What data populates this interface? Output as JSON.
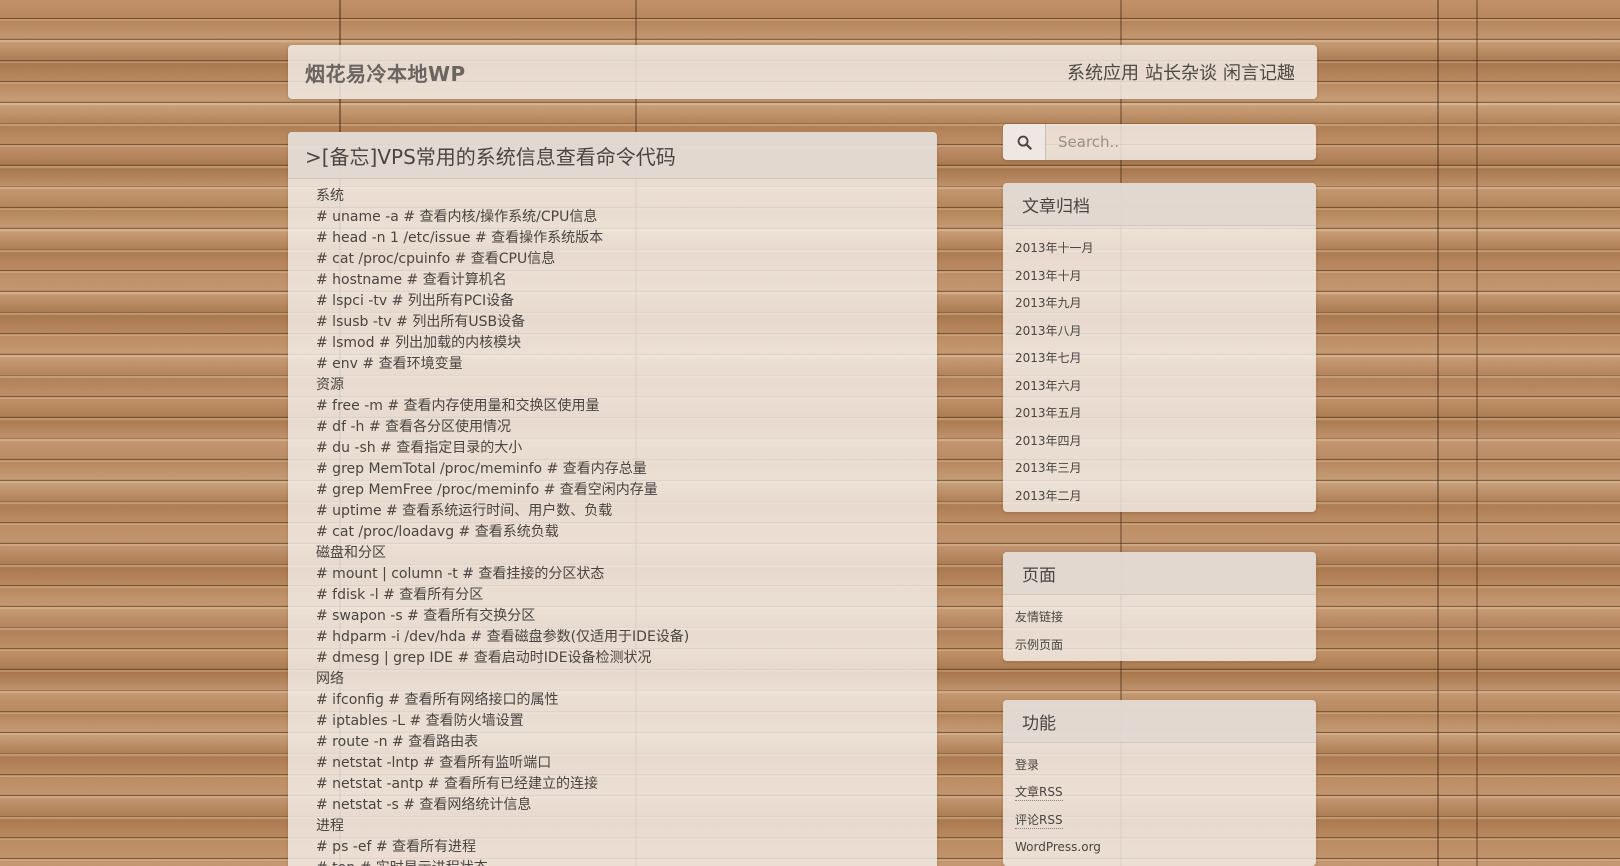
{
  "site": {
    "title": "烟花易冷本地WP",
    "nav": [
      "系统应用",
      "站长杂谈",
      "闲言记趣"
    ]
  },
  "post": {
    "title": ">[备忘]VPS常用的系统信息查看命令代码",
    "lines": [
      "系统",
      "# uname -a # 查看内核/操作系统/CPU信息",
      "# head -n 1 /etc/issue # 查看操作系统版本",
      "# cat /proc/cpuinfo # 查看CPU信息",
      "# hostname # 查看计算机名",
      "# lspci -tv # 列出所有PCI设备",
      "# lsusb -tv # 列出所有USB设备",
      "# lsmod # 列出加载的内核模块",
      "# env # 查看环境变量",
      "资源",
      "# free -m # 查看内存使用量和交换区使用量",
      "# df -h # 查看各分区使用情况",
      "# du -sh # 查看指定目录的大小",
      "# grep MemTotal /proc/meminfo # 查看内存总量",
      "# grep MemFree /proc/meminfo # 查看空闲内存量",
      "# uptime # 查看系统运行时间、用户数、负载",
      "# cat /proc/loadavg # 查看系统负载",
      "磁盘和分区",
      "# mount | column -t # 查看挂接的分区状态",
      "# fdisk -l # 查看所有分区",
      "# swapon -s # 查看所有交换分区",
      "# hdparm -i /dev/hda # 查看磁盘参数(仅适用于IDE设备)",
      "# dmesg | grep IDE # 查看启动时IDE设备检测状况",
      "网络",
      "# ifconfig # 查看所有网络接口的属性",
      "# iptables -L # 查看防火墙设置",
      "# route -n # 查看路由表",
      "# netstat -lntp # 查看所有监听端口",
      "# netstat -antp # 查看所有已经建立的连接",
      "# netstat -s # 查看网络统计信息",
      "进程",
      "# ps -ef # 查看所有进程",
      "# top # 实时显示进程状态"
    ]
  },
  "search": {
    "placeholder": "Search.."
  },
  "archive": {
    "title": "文章归档",
    "items": [
      "2013年十一月",
      "2013年十月",
      "2013年九月",
      "2013年八月",
      "2013年七月",
      "2013年六月",
      "2013年五月",
      "2013年四月",
      "2013年三月",
      "2013年二月"
    ]
  },
  "pages": {
    "title": "页面",
    "items": [
      "友情链接",
      "示例页面"
    ]
  },
  "meta": {
    "title": "功能",
    "items": [
      "登录",
      "文章RSS",
      "评论RSS",
      "WordPress.org"
    ]
  }
}
